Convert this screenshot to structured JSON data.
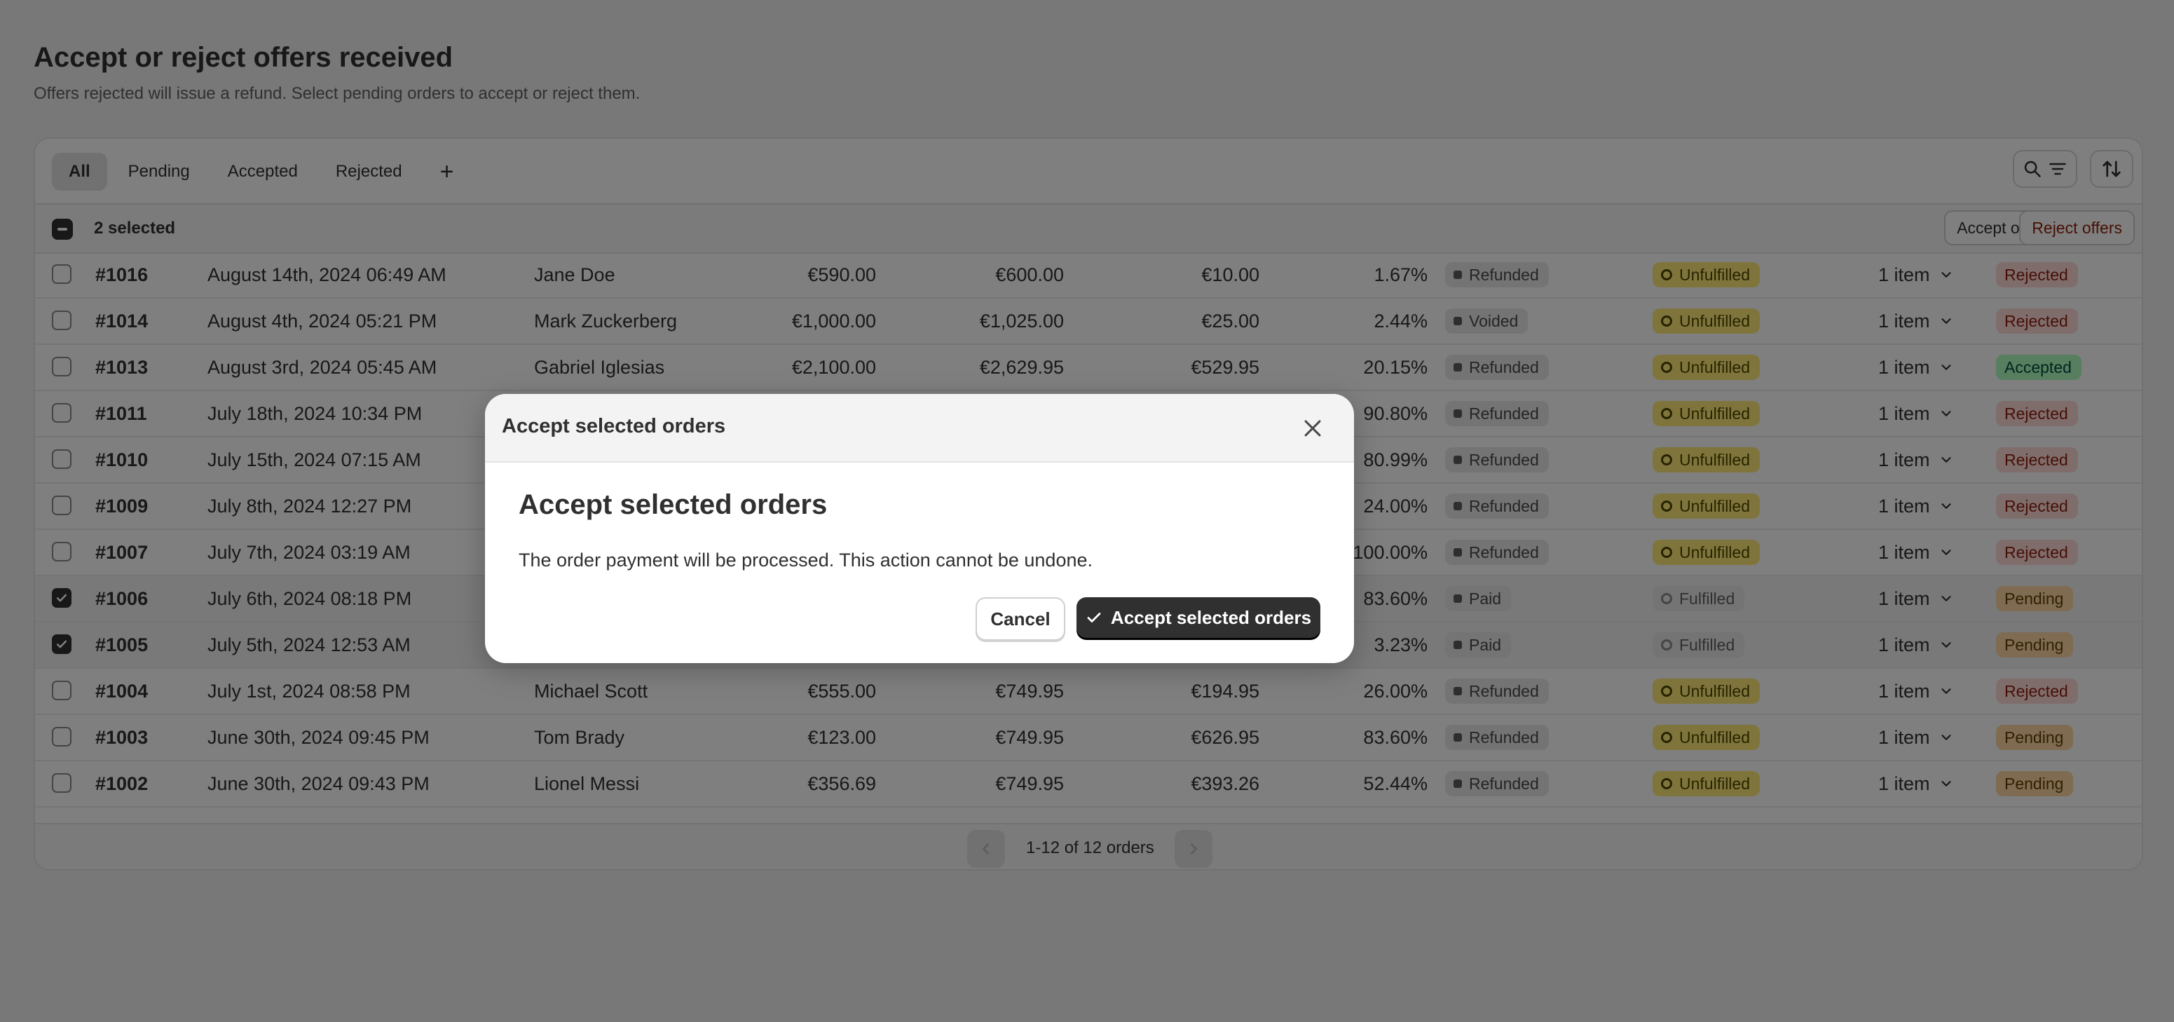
{
  "page": {
    "title": "Accept or reject offers received",
    "subtitle": "Offers rejected will issue a refund. Select pending orders to accept or reject them."
  },
  "tabs": [
    {
      "label": "All",
      "active": true
    },
    {
      "label": "Pending",
      "active": false
    },
    {
      "label": "Accepted",
      "active": false
    },
    {
      "label": "Rejected",
      "active": false
    }
  ],
  "tab_add": "+",
  "toolbar": {
    "search_icon": "search-icon",
    "filter_icon": "filter-icon",
    "sort_icon": "sort-icon"
  },
  "bulk": {
    "selected_label": "2 selected",
    "accept_label": "Accept offers",
    "reject_label": "Reject offers"
  },
  "orders": [
    {
      "id": "#1016",
      "date": "August 14th, 2024 06:49 AM",
      "customer": "Jane Doe",
      "amount1": "€590.00",
      "amount2": "€600.00",
      "amount3": "€10.00",
      "percent": "1.67%",
      "payment": "Refunded",
      "fulfillment": "Unfulfilled",
      "items": "1 item",
      "status": "Rejected",
      "selected": false
    },
    {
      "id": "#1014",
      "date": "August 4th, 2024 05:21 PM",
      "customer": "Mark Zuckerberg",
      "amount1": "€1,000.00",
      "amount2": "€1,025.00",
      "amount3": "€25.00",
      "percent": "2.44%",
      "payment": "Voided",
      "fulfillment": "Unfulfilled",
      "items": "1 item",
      "status": "Rejected",
      "selected": false
    },
    {
      "id": "#1013",
      "date": "August 3rd, 2024 05:45 AM",
      "customer": "Gabriel Iglesias",
      "amount1": "€2,100.00",
      "amount2": "€2,629.95",
      "amount3": "€529.95",
      "percent": "20.15%",
      "payment": "Refunded",
      "fulfillment": "Unfulfilled",
      "items": "1 item",
      "status": "Accepted",
      "selected": false
    },
    {
      "id": "#1011",
      "date": "July 18th, 2024 10:34 PM",
      "customer": "",
      "amount1": "",
      "amount2": "",
      "amount3": "",
      "percent": "90.80%",
      "payment": "Refunded",
      "fulfillment": "Unfulfilled",
      "items": "1 item",
      "status": "Rejected",
      "selected": false
    },
    {
      "id": "#1010",
      "date": "July 15th, 2024 07:15 AM",
      "customer": "",
      "amount1": "",
      "amount2": "",
      "amount3": "",
      "percent": "80.99%",
      "payment": "Refunded",
      "fulfillment": "Unfulfilled",
      "items": "1 item",
      "status": "Rejected",
      "selected": false
    },
    {
      "id": "#1009",
      "date": "July 8th, 2024 12:27 PM",
      "customer": "",
      "amount1": "",
      "amount2": "",
      "amount3": "",
      "percent": "24.00%",
      "payment": "Refunded",
      "fulfillment": "Unfulfilled",
      "items": "1 item",
      "status": "Rejected",
      "selected": false
    },
    {
      "id": "#1007",
      "date": "July 7th, 2024 03:19 AM",
      "customer": "",
      "amount1": "",
      "amount2": "",
      "amount3": "",
      "percent": "100.00%",
      "payment": "Refunded",
      "fulfillment": "Unfulfilled",
      "items": "1 item",
      "status": "Rejected",
      "selected": false
    },
    {
      "id": "#1006",
      "date": "July 6th, 2024 08:18 PM",
      "customer": "",
      "amount1": "",
      "amount2": "",
      "amount3": "",
      "percent": "83.60%",
      "payment": "Paid",
      "fulfillment": "Fulfilled",
      "items": "1 item",
      "status": "Pending",
      "selected": true
    },
    {
      "id": "#1005",
      "date": "July 5th, 2024 12:53 AM",
      "customer": "",
      "amount1": "",
      "amount2": "",
      "amount3": "",
      "percent": "3.23%",
      "payment": "Paid",
      "fulfillment": "Fulfilled",
      "items": "1 item",
      "status": "Pending",
      "selected": true
    },
    {
      "id": "#1004",
      "date": "July 1st, 2024 08:58 PM",
      "customer": "Michael Scott",
      "amount1": "€555.00",
      "amount2": "€749.95",
      "amount3": "€194.95",
      "percent": "26.00%",
      "payment": "Refunded",
      "fulfillment": "Unfulfilled",
      "items": "1 item",
      "status": "Rejected",
      "selected": false
    },
    {
      "id": "#1003",
      "date": "June 30th, 2024 09:45 PM",
      "customer": "Tom Brady",
      "amount1": "€123.00",
      "amount2": "€749.95",
      "amount3": "€626.95",
      "percent": "83.60%",
      "payment": "Refunded",
      "fulfillment": "Unfulfilled",
      "items": "1 item",
      "status": "Pending",
      "selected": false
    },
    {
      "id": "#1002",
      "date": "June 30th, 2024 09:43 PM",
      "customer": "Lionel Messi",
      "amount1": "€356.69",
      "amount2": "€749.95",
      "amount3": "€393.26",
      "percent": "52.44%",
      "payment": "Refunded",
      "fulfillment": "Unfulfilled",
      "items": "1 item",
      "status": "Pending",
      "selected": false
    }
  ],
  "pagination": {
    "text": "1-12 of 12 orders"
  },
  "modal": {
    "header_title": "Accept selected orders",
    "heading": "Accept selected orders",
    "body": "The order payment will be processed. This action cannot be undone.",
    "cancel_label": "Cancel",
    "confirm_label": "Accept selected orders"
  },
  "colors": {
    "overlay": "rgba(0,0,0,0.5)",
    "primary_button": "#303030",
    "rejected_badge": "#fedad9",
    "accepted_badge": "#affebf",
    "pending_badge": "#ffd6a4",
    "unfulfilled_badge": "#ffeb78"
  }
}
